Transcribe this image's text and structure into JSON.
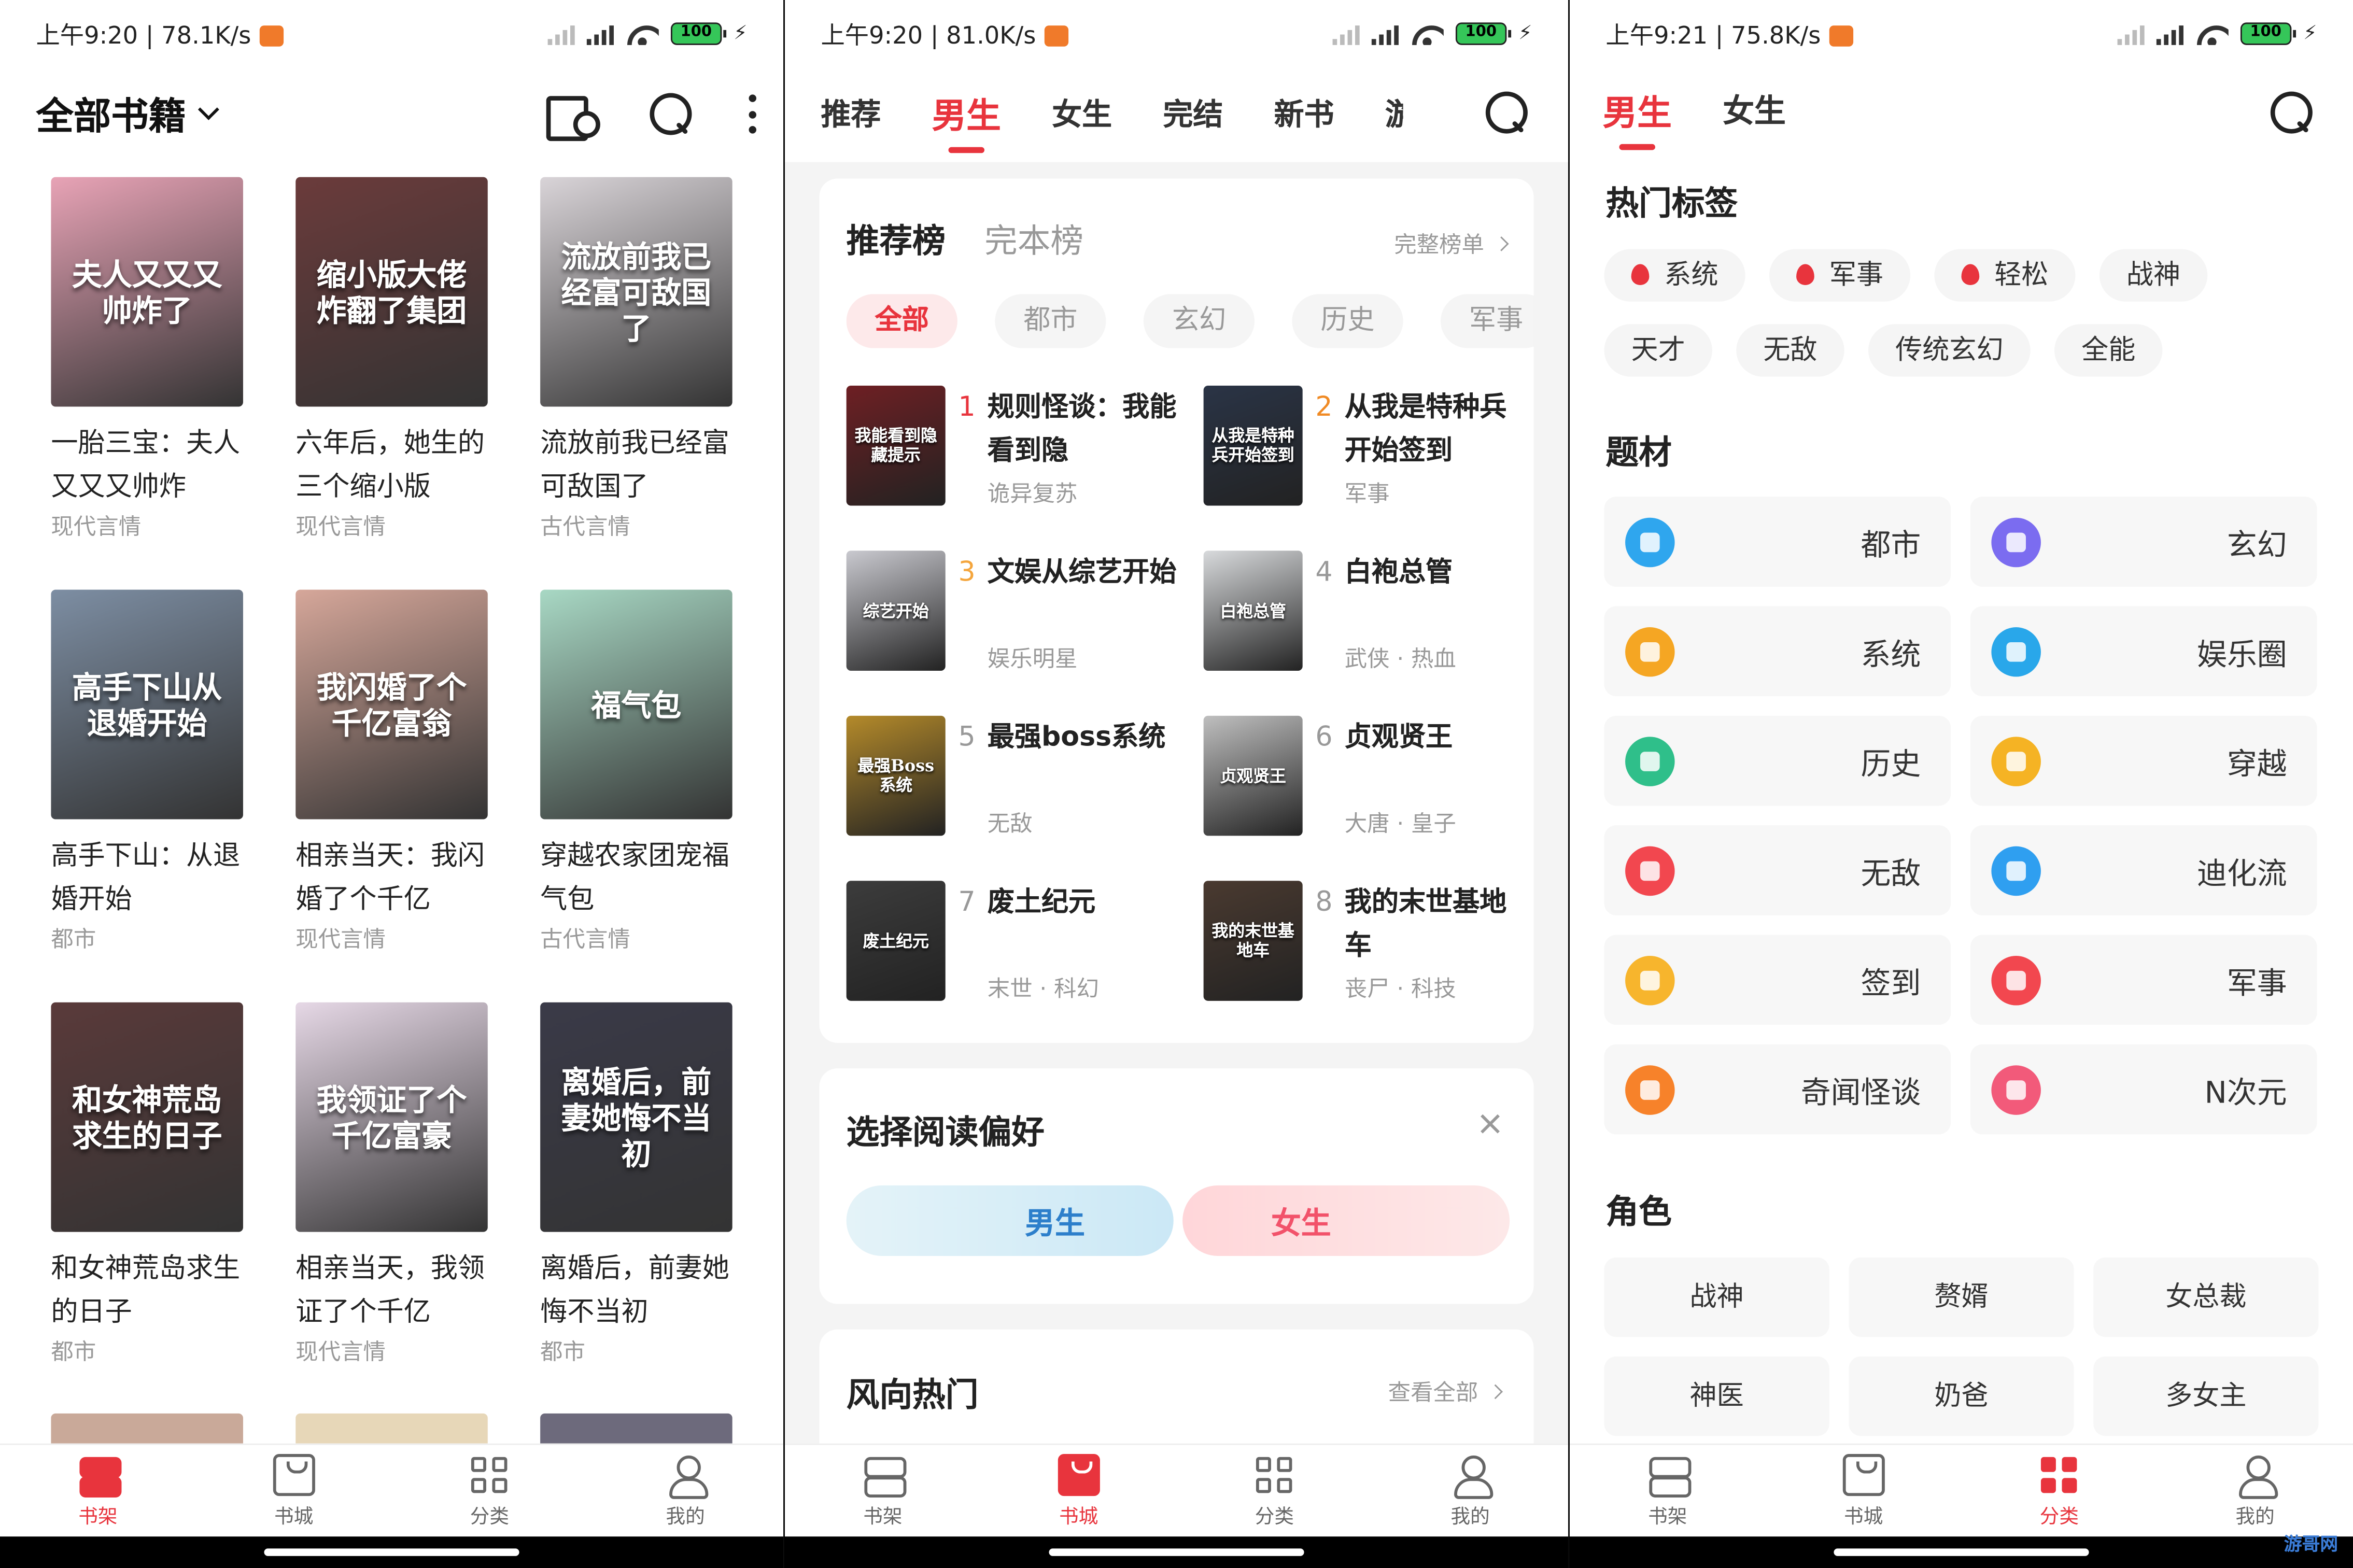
{
  "status": {
    "p1": "上午9:20 | 78.1K/s",
    "p2": "上午9:20 | 81.0K/s",
    "p3": "上午9:21 | 75.8K/s",
    "battery": "100"
  },
  "shelf": {
    "title": "全部书籍",
    "books": [
      {
        "cover_text": "夫人又又又帅炸了",
        "name": "一胎三宝：夫人又又又帅炸",
        "category": "现代言情",
        "color": "#e8a3b6"
      },
      {
        "cover_text": "缩小版大佬炸翻了集团",
        "name": "六年后，她生的三个缩小版",
        "category": "现代言情",
        "color": "#6b3b3b"
      },
      {
        "cover_text": "流放前我已经富可敌国了",
        "name": "流放前我已经富可敌国了",
        "category": "古代言情",
        "color": "#d9d4d8"
      },
      {
        "cover_text": "高手下山从退婚开始",
        "name": "高手下山：从退婚开始",
        "category": "都市",
        "color": "#7d8ea3"
      },
      {
        "cover_text": "我闪婚了个千亿富翁",
        "name": "相亲当天：我闪婚了个千亿",
        "category": "现代言情",
        "color": "#d6a79a"
      },
      {
        "cover_text": "福气包",
        "name": "穿越农家团宠福气包",
        "category": "古代言情",
        "color": "#a8d8c4"
      },
      {
        "cover_text": "和女神荒岛求生的日子",
        "name": "和女神荒岛求生的日子",
        "category": "都市",
        "color": "#5a3a3a"
      },
      {
        "cover_text": "我领证了个千亿富豪",
        "name": "相亲当天，我领证了个千亿",
        "category": "现代言情",
        "color": "#e6d8e6"
      },
      {
        "cover_text": "离婚后，前妻她悔不当初",
        "name": "离婚后，前妻她悔不当初",
        "category": "都市",
        "color": "#3a3a48"
      }
    ]
  },
  "store": {
    "tabs": [
      "推荐",
      "男生",
      "女生",
      "完结",
      "新书",
      "游"
    ],
    "active_tab": "男生",
    "rank_tabs": [
      "推荐榜",
      "完本榜"
    ],
    "rank_more": "完整榜单",
    "chips": [
      "全部",
      "都市",
      "玄幻",
      "历史",
      "军事"
    ],
    "ranks": [
      {
        "num": "1",
        "title": "规则怪谈：我能看到隐",
        "tags": "诡异复苏",
        "cover_text": "我能看到隐藏提示",
        "color": "#6e1f23"
      },
      {
        "num": "2",
        "title": "从我是特种兵开始签到",
        "tags": "军事",
        "cover_text": "从我是特种兵开始签到",
        "color": "#2a3446"
      },
      {
        "num": "3",
        "title": "文娱从综艺开始",
        "tags": "娱乐明星",
        "cover_text": "综艺开始",
        "color": "#c9c9cf"
      },
      {
        "num": "4",
        "title": "白袍总管",
        "tags": "武侠 · 热血",
        "cover_text": "白袍总管",
        "color": "#d8dadc"
      },
      {
        "num": "5",
        "title": "最强boss系统",
        "tags": "无敌",
        "cover_text": "最强Boss系统",
        "color": "#b48a2a"
      },
      {
        "num": "6",
        "title": "贞观贤王",
        "tags": "大唐 · 皇子",
        "cover_text": "贞观贤王",
        "color": "#bfbfbf"
      },
      {
        "num": "7",
        "title": "废土纪元",
        "tags": "末世 · 科幻",
        "cover_text": "废土纪元",
        "color": "#3c3c3c"
      },
      {
        "num": "8",
        "title": "我的末世基地车",
        "tags": "丧尸 · 科技",
        "cover_text": "我的末世基地车",
        "color": "#4a3a30"
      }
    ],
    "pref_title": "选择阅读偏好",
    "pref_male": "男生",
    "pref_female": "女生",
    "hot_title": "风向热门",
    "hot_more": "查看全部"
  },
  "category": {
    "tabs": [
      "男生",
      "女生"
    ],
    "hot_tags_title": "热门标签",
    "hot_tags": [
      {
        "label": "系统",
        "fire": true
      },
      {
        "label": "军事",
        "fire": true
      },
      {
        "label": "轻松",
        "fire": true
      },
      {
        "label": "战神",
        "fire": false
      },
      {
        "label": "天才",
        "fire": false
      },
      {
        "label": "无敌",
        "fire": false
      },
      {
        "label": "传统玄幻",
        "fire": false
      },
      {
        "label": "全能",
        "fire": false
      }
    ],
    "genre_title": "题材",
    "genres": [
      {
        "label": "都市",
        "color": "#2fa6ee"
      },
      {
        "label": "玄幻",
        "color": "#7b6cf0"
      },
      {
        "label": "系统",
        "color": "#f5a623"
      },
      {
        "label": "娱乐圈",
        "color": "#29a7ea"
      },
      {
        "label": "历史",
        "color": "#2fbf8a"
      },
      {
        "label": "穿越",
        "color": "#f5b324"
      },
      {
        "label": "无敌",
        "color": "#f2474f"
      },
      {
        "label": "迪化流",
        "color": "#2f9ff0"
      },
      {
        "label": "签到",
        "color": "#f7b52d"
      },
      {
        "label": "军事",
        "color": "#f2474f"
      },
      {
        "label": "奇闻怪谈",
        "color": "#f7822a"
      },
      {
        "label": "N次元",
        "color": "#f25a7a"
      }
    ],
    "role_title": "角色",
    "roles": [
      "战神",
      "赘婿",
      "女总裁",
      "神医",
      "奶爸",
      "多女主"
    ]
  },
  "nav": {
    "shelf": "书架",
    "store": "书城",
    "category": "分类",
    "me": "我的"
  },
  "accent": "#e8343d",
  "watermark": "游哥网"
}
